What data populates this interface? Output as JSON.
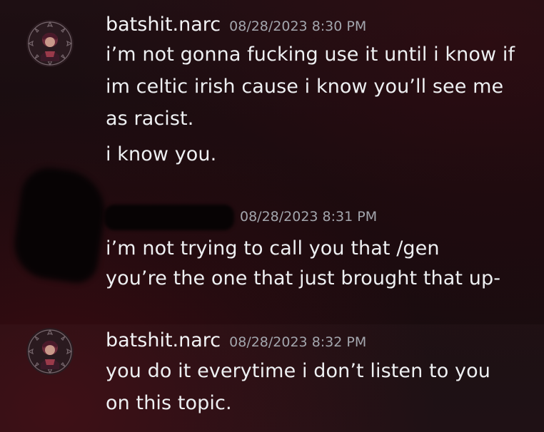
{
  "messages": [
    {
      "username": "batshit.narc",
      "timestamp": "08/28/2023 8:30 PM",
      "lines": [
        "i’m not gonna fucking use it until i know if",
        "im celtic irish cause i know you’ll see me",
        "as racist.",
        "i know you."
      ]
    },
    {
      "username": "",
      "timestamp": "08/28/2023 8:31 PM",
      "lines": [
        "i’m not trying to call you that /gen",
        "you’re the one that just brought that up-"
      ]
    },
    {
      "username": "batshit.narc",
      "timestamp": "08/28/2023 8:32 PM",
      "lines": [
        "you do it everytime i don’t listen to you",
        "on this topic."
      ]
    }
  ],
  "colors": {
    "background": "#1a0d11",
    "username": "#f2f3f5",
    "timestamp": "#a3a6ad",
    "message_text": "#eef0f2"
  },
  "icons": {
    "avatar": "user-avatar-icon"
  }
}
